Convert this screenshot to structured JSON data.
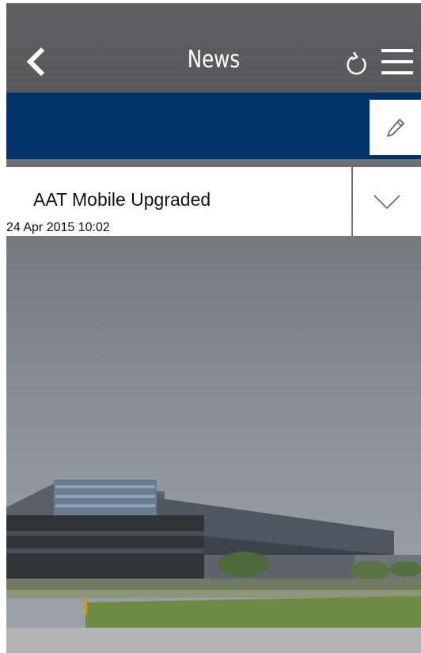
{
  "header": {
    "title": "News",
    "back_icon": "chevron-left-icon",
    "refresh_icon": "refresh-icon",
    "menu_icon": "hamburger-menu-icon"
  },
  "toolbar": {
    "edit_icon": "pencil-icon",
    "bar_color": "#003468"
  },
  "news": {
    "items": [
      {
        "title": "AAT Mobile Upgraded",
        "date": "24 Apr 2015 10:02",
        "expand_icon": "chevron-down-icon"
      }
    ]
  },
  "colors": {
    "header_bg": "#5b5d61",
    "accent_blue": "#003468",
    "card_bg": "#ffffff"
  }
}
